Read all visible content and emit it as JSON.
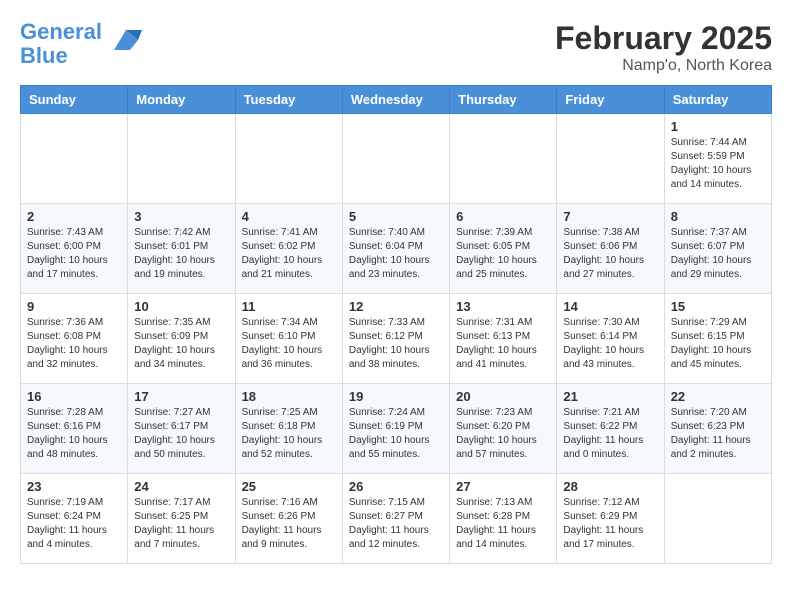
{
  "logo": {
    "line1": "General",
    "line2": "Blue"
  },
  "header": {
    "title": "February 2025",
    "location": "Namp'o, North Korea"
  },
  "weekdays": [
    "Sunday",
    "Monday",
    "Tuesday",
    "Wednesday",
    "Thursday",
    "Friday",
    "Saturday"
  ],
  "weeks": [
    [
      {
        "day": "",
        "info": ""
      },
      {
        "day": "",
        "info": ""
      },
      {
        "day": "",
        "info": ""
      },
      {
        "day": "",
        "info": ""
      },
      {
        "day": "",
        "info": ""
      },
      {
        "day": "",
        "info": ""
      },
      {
        "day": "1",
        "info": "Sunrise: 7:44 AM\nSunset: 5:59 PM\nDaylight: 10 hours and 14 minutes."
      }
    ],
    [
      {
        "day": "2",
        "info": "Sunrise: 7:43 AM\nSunset: 6:00 PM\nDaylight: 10 hours and 17 minutes."
      },
      {
        "day": "3",
        "info": "Sunrise: 7:42 AM\nSunset: 6:01 PM\nDaylight: 10 hours and 19 minutes."
      },
      {
        "day": "4",
        "info": "Sunrise: 7:41 AM\nSunset: 6:02 PM\nDaylight: 10 hours and 21 minutes."
      },
      {
        "day": "5",
        "info": "Sunrise: 7:40 AM\nSunset: 6:04 PM\nDaylight: 10 hours and 23 minutes."
      },
      {
        "day": "6",
        "info": "Sunrise: 7:39 AM\nSunset: 6:05 PM\nDaylight: 10 hours and 25 minutes."
      },
      {
        "day": "7",
        "info": "Sunrise: 7:38 AM\nSunset: 6:06 PM\nDaylight: 10 hours and 27 minutes."
      },
      {
        "day": "8",
        "info": "Sunrise: 7:37 AM\nSunset: 6:07 PM\nDaylight: 10 hours and 29 minutes."
      }
    ],
    [
      {
        "day": "9",
        "info": "Sunrise: 7:36 AM\nSunset: 6:08 PM\nDaylight: 10 hours and 32 minutes."
      },
      {
        "day": "10",
        "info": "Sunrise: 7:35 AM\nSunset: 6:09 PM\nDaylight: 10 hours and 34 minutes."
      },
      {
        "day": "11",
        "info": "Sunrise: 7:34 AM\nSunset: 6:10 PM\nDaylight: 10 hours and 36 minutes."
      },
      {
        "day": "12",
        "info": "Sunrise: 7:33 AM\nSunset: 6:12 PM\nDaylight: 10 hours and 38 minutes."
      },
      {
        "day": "13",
        "info": "Sunrise: 7:31 AM\nSunset: 6:13 PM\nDaylight: 10 hours and 41 minutes."
      },
      {
        "day": "14",
        "info": "Sunrise: 7:30 AM\nSunset: 6:14 PM\nDaylight: 10 hours and 43 minutes."
      },
      {
        "day": "15",
        "info": "Sunrise: 7:29 AM\nSunset: 6:15 PM\nDaylight: 10 hours and 45 minutes."
      }
    ],
    [
      {
        "day": "16",
        "info": "Sunrise: 7:28 AM\nSunset: 6:16 PM\nDaylight: 10 hours and 48 minutes."
      },
      {
        "day": "17",
        "info": "Sunrise: 7:27 AM\nSunset: 6:17 PM\nDaylight: 10 hours and 50 minutes."
      },
      {
        "day": "18",
        "info": "Sunrise: 7:25 AM\nSunset: 6:18 PM\nDaylight: 10 hours and 52 minutes."
      },
      {
        "day": "19",
        "info": "Sunrise: 7:24 AM\nSunset: 6:19 PM\nDaylight: 10 hours and 55 minutes."
      },
      {
        "day": "20",
        "info": "Sunrise: 7:23 AM\nSunset: 6:20 PM\nDaylight: 10 hours and 57 minutes."
      },
      {
        "day": "21",
        "info": "Sunrise: 7:21 AM\nSunset: 6:22 PM\nDaylight: 11 hours and 0 minutes."
      },
      {
        "day": "22",
        "info": "Sunrise: 7:20 AM\nSunset: 6:23 PM\nDaylight: 11 hours and 2 minutes."
      }
    ],
    [
      {
        "day": "23",
        "info": "Sunrise: 7:19 AM\nSunset: 6:24 PM\nDaylight: 11 hours and 4 minutes."
      },
      {
        "day": "24",
        "info": "Sunrise: 7:17 AM\nSunset: 6:25 PM\nDaylight: 11 hours and 7 minutes."
      },
      {
        "day": "25",
        "info": "Sunrise: 7:16 AM\nSunset: 6:26 PM\nDaylight: 11 hours and 9 minutes."
      },
      {
        "day": "26",
        "info": "Sunrise: 7:15 AM\nSunset: 6:27 PM\nDaylight: 11 hours and 12 minutes."
      },
      {
        "day": "27",
        "info": "Sunrise: 7:13 AM\nSunset: 6:28 PM\nDaylight: 11 hours and 14 minutes."
      },
      {
        "day": "28",
        "info": "Sunrise: 7:12 AM\nSunset: 6:29 PM\nDaylight: 11 hours and 17 minutes."
      },
      {
        "day": "",
        "info": ""
      }
    ]
  ]
}
